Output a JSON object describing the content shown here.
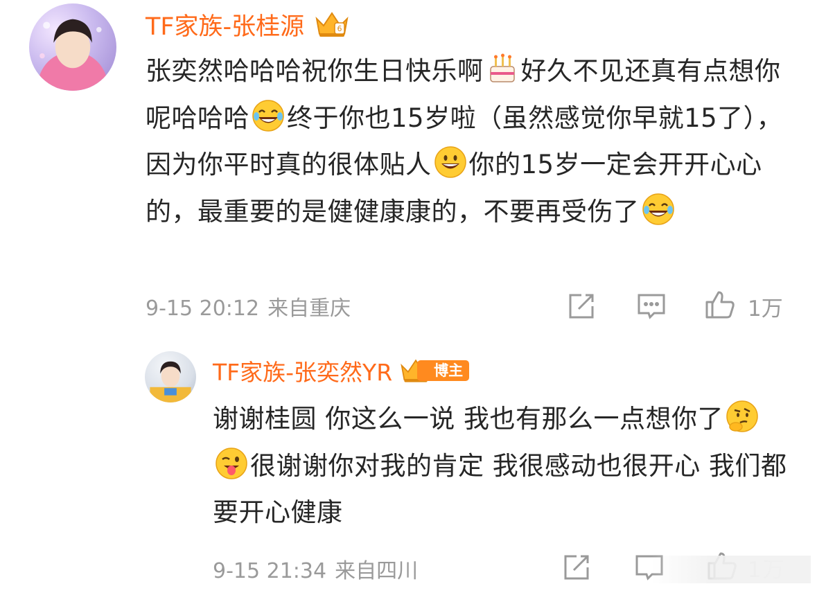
{
  "comment": {
    "author": "TF家族-张桂源",
    "text_parts": [
      "张奕然哈哈哈祝你生日快乐啊",
      "好久不见还真有点想你呢哈哈哈",
      "终于你也15岁啦（虽然感觉你早就15了），因为你平时真的很体贴人",
      "你的15岁一定会开开心心的，最重要的是健健康康的，不要再受伤了"
    ],
    "emojis": [
      "cake-emoji",
      "laugh-cry-emoji",
      "grin-emoji",
      "laugh-cry-emoji"
    ],
    "time": "9-15 20:12",
    "location": "来自重庆",
    "likes": "1万"
  },
  "reply": {
    "author": "TF家族-张奕然YR",
    "badge": "博主",
    "text_parts": [
      "谢谢桂圆 你这么一说 我也有那么一点想你了",
      "很谢谢你对我的肯定 我很感动也很开心 我们都要开心健康"
    ],
    "emojis": [
      "thinking-emoji",
      "tongue-wink-emoji"
    ],
    "time": "9-15 21:34",
    "location": "来自四川",
    "likes": "1万"
  },
  "colors": {
    "name": "#ff6a1a",
    "badge": "#ff8a1f",
    "text": "#262626",
    "meta": "#9a9a9a"
  }
}
